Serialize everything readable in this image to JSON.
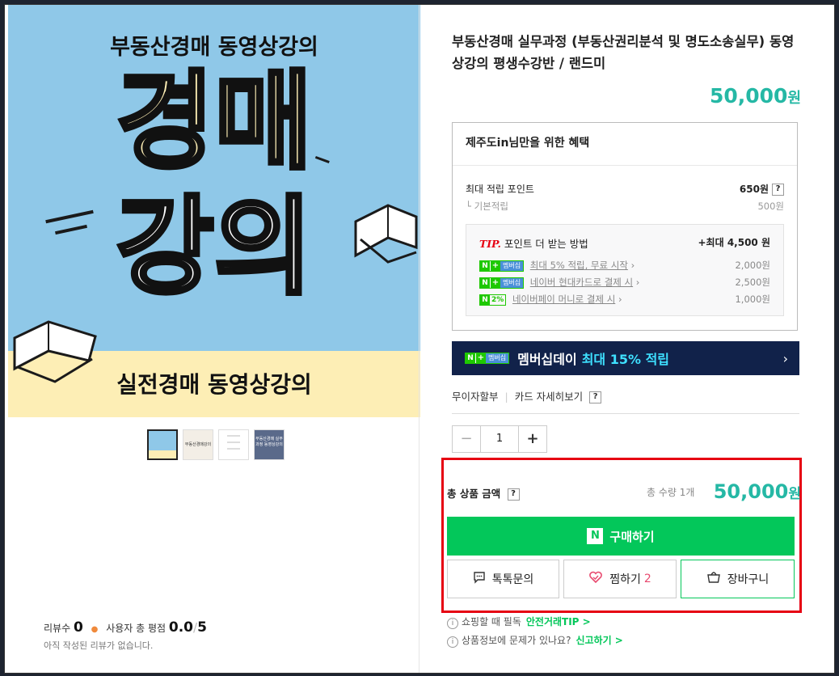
{
  "product": {
    "title": "부동산경매 실무과정 (부동산권리분석 및 명도소송실무) 동영상강의 평생수강반 / 랜드미",
    "price": "50,000",
    "won": "원",
    "image": {
      "top": "부동산경매 동영상강의",
      "big1": "경매",
      "big2": "강의",
      "bottom": "실전경매 동영상강의"
    },
    "thumb_texts": [
      "부동산경매강의",
      "부동산경매 실무과정 동영상강의"
    ]
  },
  "review": {
    "count_label": "리뷰수",
    "count": "0",
    "rating_label": "사용자 총 평점",
    "rating": "0.0",
    "rating_max": "5",
    "empty": "아직 작성된 리뷰가 없습니다."
  },
  "benefit": {
    "header": "제주도in님만을 위한 혜택",
    "max_points_label": "최대 적립 포인트",
    "max_points": "650원",
    "basic_label": "└ 기본적립",
    "basic": "500원",
    "tip_label": "TIP.",
    "tip_text": "포인트 더 받는 방법",
    "tip_max": "+최대 4,500 원",
    "tips": [
      {
        "badge": "멤버십",
        "text": "최대 5% 적립, 무료 시작",
        "amount": "2,000원"
      },
      {
        "badge": "멤버십",
        "text": "네이버 현대카드로 결제 시",
        "amount": "2,500원"
      },
      {
        "badge": "2%",
        "text": "네이버페이 머니로 결제 시",
        "amount": "1,000원"
      }
    ]
  },
  "membership_bar": {
    "badge": "멤버십",
    "text": "멤버십데이",
    "highlight": "최대 15% 적립"
  },
  "card": {
    "installment": "무이자할부",
    "detail": "카드 자세히보기"
  },
  "quantity": {
    "value": "1",
    "minus": "−",
    "plus": "+"
  },
  "total": {
    "label": "총 상품 금액",
    "qty": "총 수량 1개",
    "price": "50,000",
    "won": "원"
  },
  "buttons": {
    "buy": "구매하기",
    "talk": "톡톡문의",
    "wish": "찜하기",
    "wish_count": "2",
    "cart": "장바구니"
  },
  "footer": {
    "line1": "쇼핑할 때 필독",
    "link1": "안전거래TIP >",
    "line2": "상품정보에 문제가 있나요?",
    "link2": "신고하기 >"
  },
  "colors": {
    "accent": "#25b8a5",
    "naver_green": "#03c75a",
    "highlight_box": "#e60012",
    "member_bg": "#11224a"
  }
}
